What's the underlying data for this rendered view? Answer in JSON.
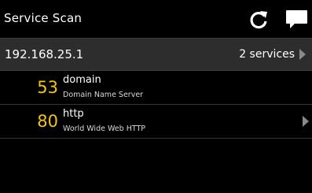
{
  "app": {
    "title": "Service Scan",
    "actions": [
      {
        "name": "refresh",
        "icon": "refresh-icon"
      },
      {
        "name": "message",
        "icon": "chat-bubble-icon"
      }
    ]
  },
  "host": {
    "ip": "192.168.25.1",
    "services_label": "2 services"
  },
  "services": [
    {
      "port": "53",
      "name": "domain",
      "description": "Domain Name Server",
      "has_chevron": false
    },
    {
      "port": "80",
      "name": "http",
      "description": "World Wide Web HTTP",
      "has_chevron": true
    }
  ],
  "colors": {
    "background": "#000000",
    "host_bar": "#2d2d2d",
    "port_number": "#f0c419",
    "chevron": "#8a8a8a"
  }
}
